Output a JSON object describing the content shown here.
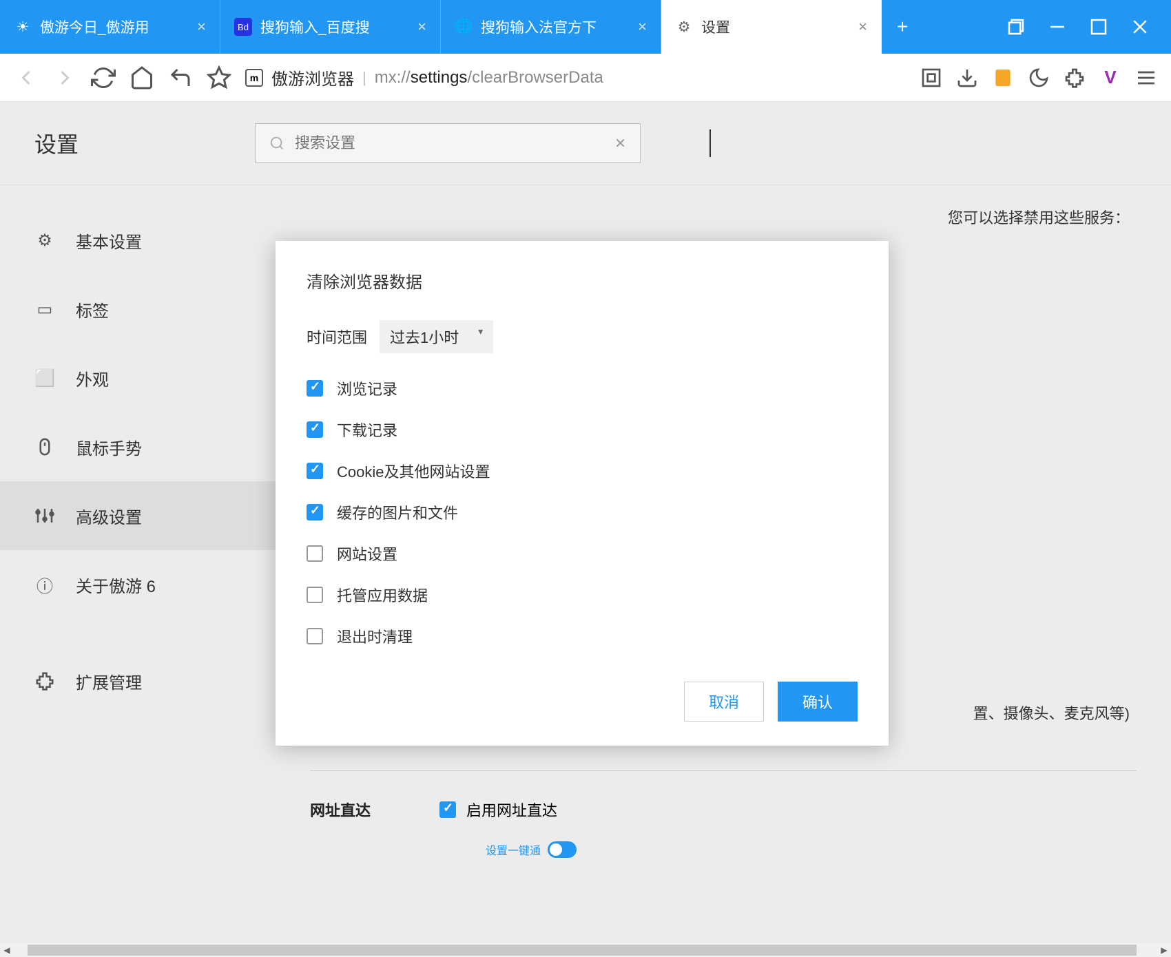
{
  "tabs": [
    {
      "title": "傲游今日_傲游用",
      "icon": "sun"
    },
    {
      "title": "搜狗输入_百度搜",
      "icon": "baidu"
    },
    {
      "title": "搜狗输入法官方下",
      "icon": "globe"
    },
    {
      "title": "设置",
      "icon": "gear",
      "active": true
    }
  ],
  "address": {
    "label": "傲游浏览器",
    "url_prefix": "mx://",
    "url_bold": "settings",
    "url_suffix": "/clearBrowserData"
  },
  "settings": {
    "title": "设置",
    "search_placeholder": "搜索设置"
  },
  "sidebar": [
    {
      "icon": "gear",
      "label": "基本设置"
    },
    {
      "icon": "tab",
      "label": "标签"
    },
    {
      "icon": "window",
      "label": "外观"
    },
    {
      "icon": "mouse",
      "label": "鼠标手势"
    },
    {
      "icon": "sliders",
      "label": "高级设置",
      "active": true
    },
    {
      "icon": "info",
      "label": "关于傲游 6"
    },
    {
      "icon": "ext",
      "label": "扩展管理",
      "sep": true
    }
  ],
  "bg": {
    "text1": "您可以选择禁用这些服务：",
    "text2": "置、摄像头、麦克风等)"
  },
  "dialog": {
    "title": "清除浏览器数据",
    "time_label": "时间范围",
    "time_value": "过去1小时",
    "items": [
      {
        "label": "浏览记录",
        "checked": true
      },
      {
        "label": "下载记录",
        "checked": true
      },
      {
        "label": "Cookie及其他网站设置",
        "checked": true
      },
      {
        "label": "缓存的图片和文件",
        "checked": true
      },
      {
        "label": "网站设置",
        "checked": false
      },
      {
        "label": "托管应用数据",
        "checked": false
      },
      {
        "label": "退出时清理",
        "checked": false
      }
    ],
    "cancel": "取消",
    "confirm": "确认"
  },
  "section": {
    "label": "网址直达",
    "check": "启用网址直达",
    "link": "设置一键通"
  }
}
